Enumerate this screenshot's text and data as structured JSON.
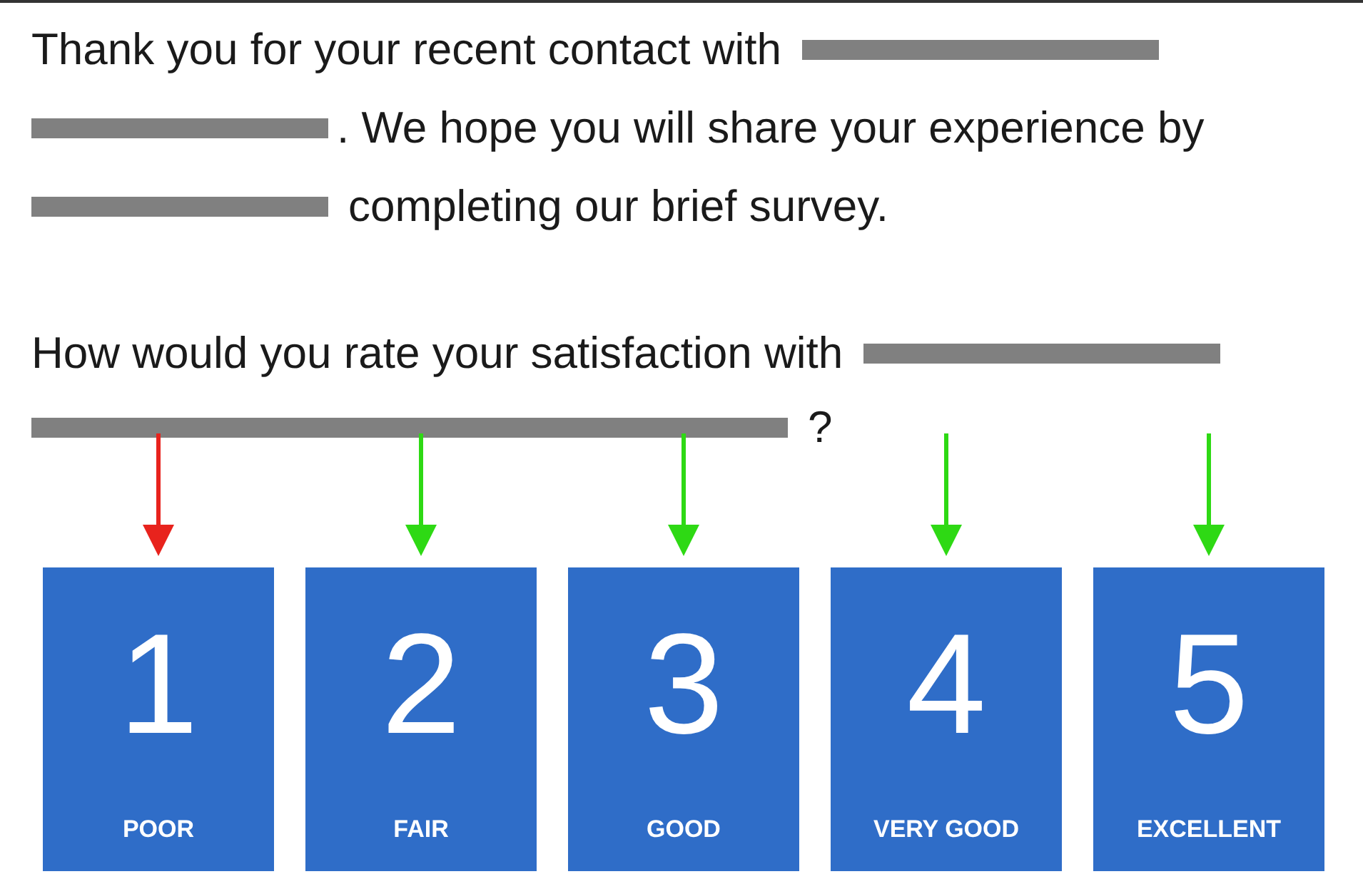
{
  "intro": [
    {
      "segments": [
        {
          "kind": "text",
          "text": "Thank you for your recent contact with"
        },
        {
          "kind": "redaction_long"
        }
      ]
    },
    {
      "segments": [
        {
          "kind": "redaction_short"
        },
        {
          "kind": "text",
          "text": ". We hope you will share your experience by"
        }
      ]
    },
    {
      "segments": [
        {
          "kind": "redaction_short"
        },
        {
          "kind": "text",
          "text": "completing our brief survey."
        }
      ]
    }
  ],
  "question": [
    {
      "segments": [
        {
          "kind": "text",
          "text": "How would you rate your satisfaction with"
        },
        {
          "kind": "redaction_long"
        }
      ]
    },
    {
      "segments": [
        {
          "kind": "redaction_wide"
        },
        {
          "kind": "text",
          "text": "?"
        }
      ]
    }
  ],
  "ratings": [
    {
      "number": "1",
      "label": "POOR",
      "color": "#e8231d"
    },
    {
      "number": "2",
      "label": "FAIR",
      "color": "#2ed914"
    },
    {
      "number": "3",
      "label": "GOOD",
      "color": "#2ed914"
    },
    {
      "number": "4",
      "label": "VERY GOOD",
      "color": "#2ed914"
    },
    {
      "number": "5",
      "label": "EXCELLENT",
      "color": "#2ed914"
    }
  ]
}
